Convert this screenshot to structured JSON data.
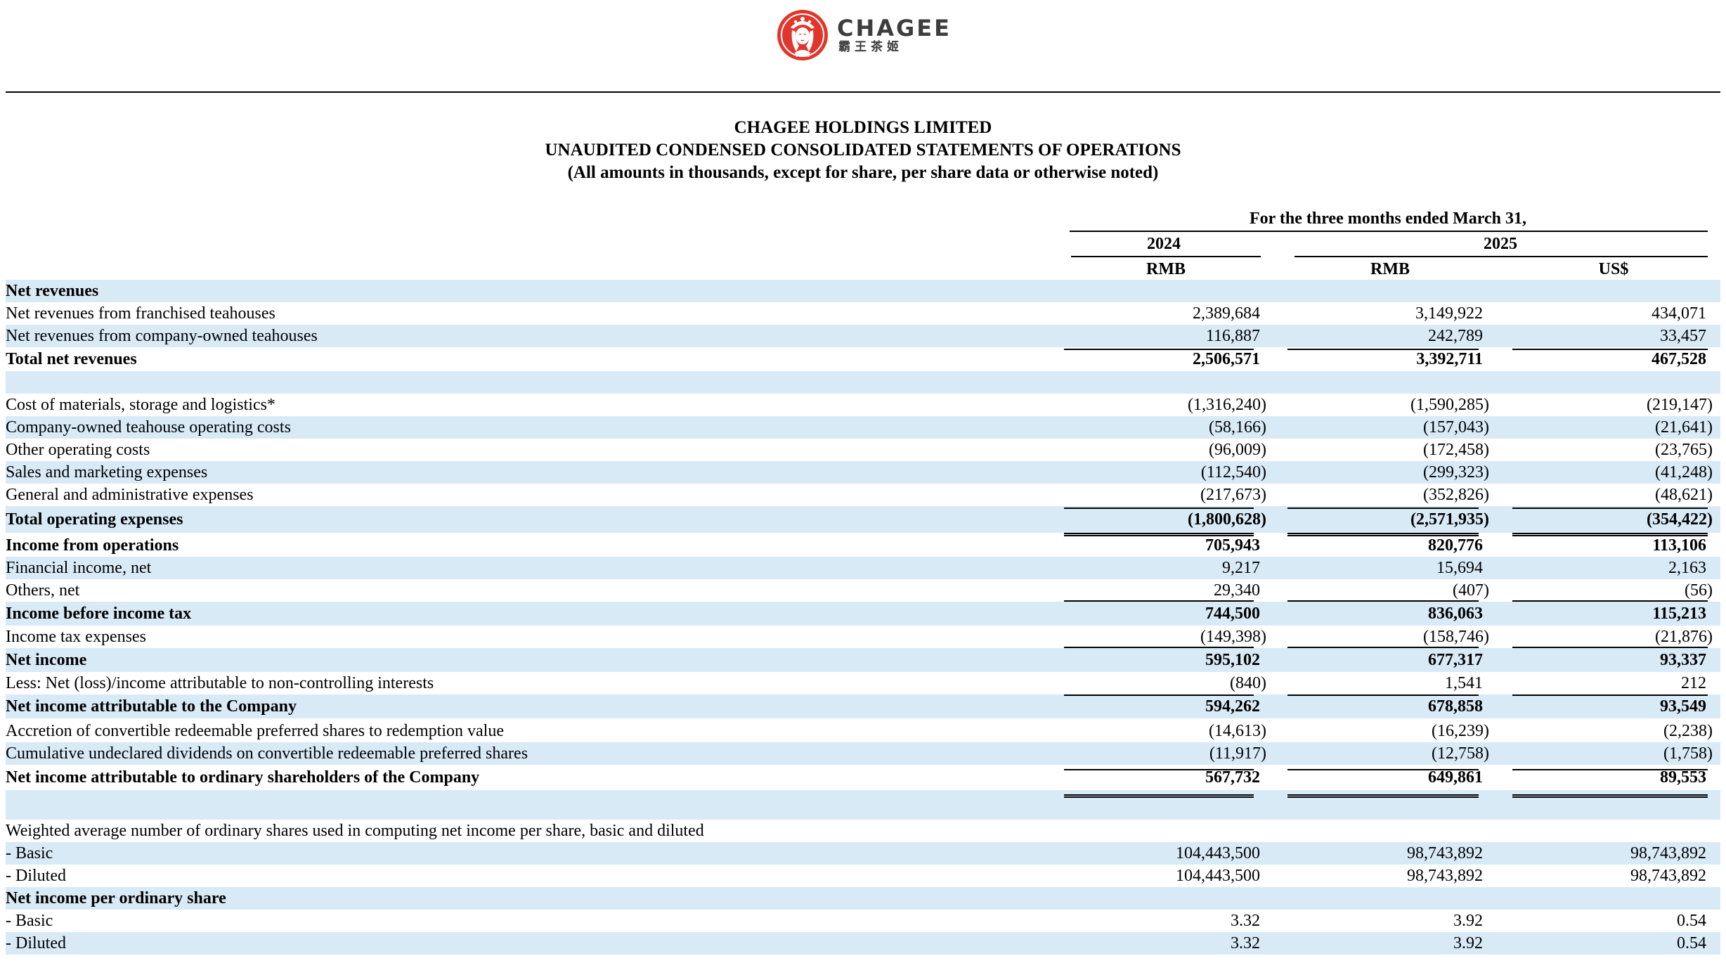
{
  "logo": {
    "brand": "CHAGEE",
    "sub": "霸王茶姬",
    "color": "#e0362c"
  },
  "header": {
    "company": "CHAGEE HOLDINGS LIMITED",
    "statement": "UNAUDITED CONDENSED CONSOLIDATED STATEMENTS OF OPERATIONS",
    "note": "(All amounts in thousands, except for share, per share data or otherwise noted)"
  },
  "columns": {
    "period": "For the three months ended March 31,",
    "year_2024": "2024",
    "year_2025": "2025",
    "cur_2024": "RMB",
    "cur_2025_rmb": "RMB",
    "cur_2025_usd": "US$"
  },
  "rows": [
    {
      "label": "Net revenues",
      "bold": true,
      "alt": true,
      "vals": [
        "",
        "",
        ""
      ]
    },
    {
      "label": "Net revenues from franchised teahouses",
      "alt": false,
      "vals": [
        "2,389,684",
        "3,149,922",
        "434,071"
      ]
    },
    {
      "label": "Net revenues from company-owned teahouses",
      "alt": true,
      "vals": [
        "116,887",
        "242,789",
        "33,457"
      ]
    },
    {
      "label": "Total net revenues",
      "bold": true,
      "alt": false,
      "vals": [
        "2,506,571",
        "3,392,711",
        "467,528"
      ]
    },
    {
      "label": "",
      "alt": true,
      "vals": [
        "",
        "",
        ""
      ]
    },
    {
      "label": "Cost of materials, storage and logistics*",
      "alt": false,
      "vals": [
        "(1,316,240)",
        "(1,590,285)",
        "(219,147)"
      ]
    },
    {
      "label": "Company-owned teahouse operating costs",
      "alt": true,
      "vals": [
        "(58,166)",
        "(157,043)",
        "(21,641)"
      ]
    },
    {
      "label": "Other operating costs",
      "alt": false,
      "vals": [
        "(96,009)",
        "(172,458)",
        "(23,765)"
      ]
    },
    {
      "label": "Sales and marketing expenses",
      "alt": true,
      "vals": [
        "(112,540)",
        "(299,323)",
        "(41,248)"
      ]
    },
    {
      "label": "General and administrative expenses",
      "alt": false,
      "vals": [
        "(217,673)",
        "(352,826)",
        "(48,621)"
      ]
    },
    {
      "label": "Total operating expenses",
      "bold": true,
      "alt": true,
      "vals": [
        "(1,800,628)",
        "(2,571,935)",
        "(354,422)"
      ]
    },
    {
      "label": "Income from operations",
      "bold": true,
      "alt": false,
      "vals": [
        "705,943",
        "820,776",
        "113,106"
      ]
    },
    {
      "label": "Financial income, net",
      "alt": true,
      "vals": [
        "9,217",
        "15,694",
        "2,163"
      ]
    },
    {
      "label": "Others, net",
      "alt": false,
      "vals": [
        "29,340",
        "(407)",
        "(56)"
      ]
    },
    {
      "label": "Income before income tax",
      "bold": true,
      "alt": true,
      "vals": [
        "744,500",
        "836,063",
        "115,213"
      ]
    },
    {
      "label": "Income tax expenses",
      "alt": false,
      "vals": [
        "(149,398)",
        "(158,746)",
        "(21,876)"
      ]
    },
    {
      "label": "Net income",
      "bold": true,
      "alt": true,
      "vals": [
        "595,102",
        "677,317",
        "93,337"
      ]
    },
    {
      "label": "Less: Net (loss)/income attributable to non-controlling interests",
      "alt": false,
      "vals": [
        "(840)",
        "1,541",
        "212"
      ]
    },
    {
      "label": "Net income attributable to the Company",
      "bold": true,
      "alt": true,
      "vals": [
        "594,262",
        "678,858",
        "93,549"
      ]
    },
    {
      "label": "Accretion of convertible redeemable preferred shares to redemption value",
      "alt": false,
      "vals": [
        "(14,613)",
        "(16,239)",
        "(2,238)"
      ]
    },
    {
      "label": "Cumulative undeclared dividends on convertible redeemable preferred shares",
      "alt": true,
      "vals": [
        "(11,917)",
        "(12,758)",
        "(1,758)"
      ]
    },
    {
      "label": "Net income attributable to ordinary shareholders of the Company",
      "bold": true,
      "alt": false,
      "vals": [
        "567,732",
        "649,861",
        "89,553"
      ]
    },
    {
      "label": "",
      "alt": true,
      "vals": [
        "",
        "",
        ""
      ]
    },
    {
      "label": "Weighted average number of ordinary shares used in computing net income per share, basic and diluted",
      "alt": false,
      "vals": [
        "",
        "",
        ""
      ]
    },
    {
      "label": "- Basic",
      "alt": true,
      "vals": [
        "104,443,500",
        "98,743,892",
        "98,743,892"
      ]
    },
    {
      "label": "- Diluted",
      "alt": false,
      "vals": [
        "104,443,500",
        "98,743,892",
        "98,743,892"
      ]
    },
    {
      "label": "Net income per ordinary share",
      "bold": true,
      "alt": true,
      "vals": [
        "",
        "",
        ""
      ]
    },
    {
      "label": "- Basic",
      "alt": false,
      "vals": [
        "3.32",
        "3.92",
        "0.54"
      ]
    },
    {
      "label": "- Diluted",
      "alt": true,
      "vals": [
        "3.32",
        "3.92",
        "0.54"
      ]
    }
  ]
}
